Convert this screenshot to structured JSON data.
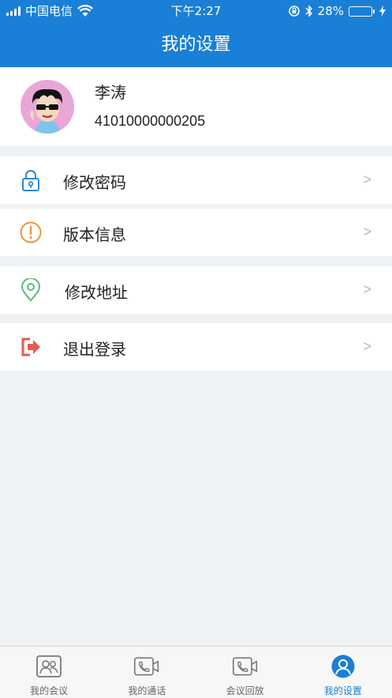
{
  "status_bar": {
    "carrier": "中国电信",
    "time": "下午2:27",
    "battery": "28%"
  },
  "nav": {
    "title": "我的设置"
  },
  "profile": {
    "name": "李涛",
    "id": "41010000000205"
  },
  "menu": [
    {
      "label": "修改密码",
      "icon": "lock-icon",
      "color": "#2b8ad6"
    },
    {
      "label": "版本信息",
      "icon": "info-icon",
      "color": "#e8963a"
    },
    {
      "label": "修改地址",
      "icon": "location-pin-icon",
      "color": "#5cba7d"
    },
    {
      "label": "退出登录",
      "icon": "logout-icon",
      "color": "#e85a4f"
    }
  ],
  "chevron": ">",
  "tabs": [
    {
      "label": "我的会议",
      "icon": "meeting-icon",
      "active": false
    },
    {
      "label": "我的通话",
      "icon": "call-icon",
      "active": false
    },
    {
      "label": "会议回放",
      "icon": "playback-icon",
      "active": false
    },
    {
      "label": "我的设置",
      "icon": "user-settings-icon",
      "active": true
    }
  ],
  "colors": {
    "primary": "#1a7fd6",
    "background": "#eef2f5"
  }
}
